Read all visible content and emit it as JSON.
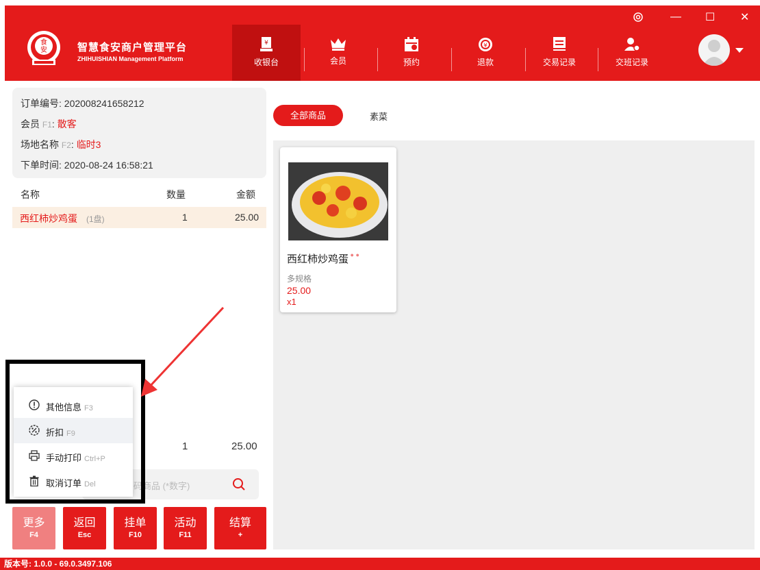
{
  "brand": {
    "title": "智慧食安商户管理平台",
    "subtitle": "ZHIHUISHIAN Management Platform",
    "logo_text": "食\n安"
  },
  "nav": [
    {
      "label": "收银台",
      "icon": "cashier-icon"
    },
    {
      "label": "会员",
      "icon": "crown-icon"
    },
    {
      "label": "预约",
      "icon": "calendar-icon"
    },
    {
      "label": "退款",
      "icon": "refund-icon"
    },
    {
      "label": "交易记录",
      "icon": "receipt-icon"
    },
    {
      "label": "交班记录",
      "icon": "user-shift-icon"
    }
  ],
  "window": {
    "settings": "settings-icon",
    "minimize": "—",
    "maximize": "☐",
    "close": "✕"
  },
  "order": {
    "number_label": "订单编号: ",
    "number": "202008241658212",
    "member_label": "会员 ",
    "member_key": "F1",
    "member_value": "散客",
    "venue_label": "场地名称 ",
    "venue_key": "F2",
    "venue_value": "临时3",
    "time_label": "下单时间: ",
    "time": "2020-08-24 16:58:21"
  },
  "table": {
    "headers": {
      "name": "名称",
      "qty": "数量",
      "amount": "金额"
    },
    "rows": [
      {
        "name": "西红柿炒鸡蛋",
        "spec": "(1盘)",
        "qty": "1",
        "amount": "25.00"
      }
    ]
  },
  "totals": {
    "qty": "1",
    "amount": "25.00"
  },
  "search": {
    "placeholder": "码商品 (*数字)"
  },
  "popup_menu": [
    {
      "label": "其他信息",
      "hint": "F3",
      "icon": "info-icon"
    },
    {
      "label": "折扣",
      "hint": "F9",
      "icon": "discount-icon"
    },
    {
      "label": "手动打印",
      "hint": "Ctrl+P",
      "icon": "printer-icon"
    },
    {
      "label": "取消订单",
      "hint": "Del",
      "icon": "trash-icon"
    }
  ],
  "actions": [
    {
      "label": "更多",
      "key": "F4"
    },
    {
      "label": "返回",
      "key": "Esc"
    },
    {
      "label": "挂单",
      "key": "F10"
    },
    {
      "label": "活动",
      "key": "F11"
    },
    {
      "label": "结算",
      "key": "+"
    }
  ],
  "categories": {
    "all": "全部商品",
    "veg": "素菜"
  },
  "product": {
    "name": "西红柿炒鸡蛋",
    "spec": "多规格",
    "price": "25.00",
    "qty": "x1"
  },
  "footer": {
    "version": "版本号: 1.0.0 - 69.0.3497.106"
  },
  "colors": {
    "brand_red": "#e41b1b",
    "active_nav": "#c01010",
    "highlight_row": "#fbefe2"
  }
}
